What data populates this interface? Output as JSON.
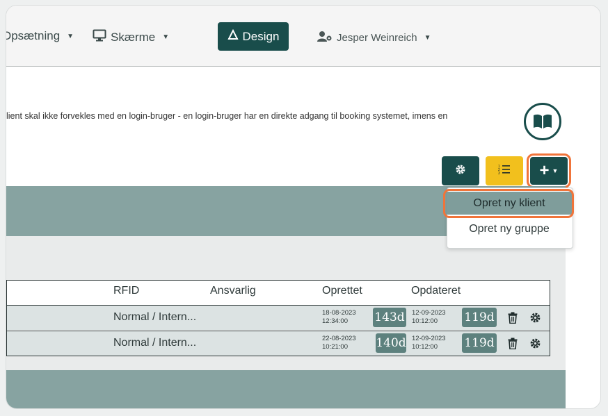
{
  "nav": {
    "opsaetning_label": "Opsætning",
    "skaerme_label": "Skærme",
    "design_label": "Design",
    "user_name": "Jesper Weinreich"
  },
  "description": "lient skal ikke forvekles med en login-bruger - en login-bruger har en direkte adgang til booking systemet, imens en",
  "dropdown": {
    "item1": "Opret ny klient",
    "item2": "Opret ny gruppe"
  },
  "table": {
    "headers": {
      "rfid": "RFID",
      "ansvarlig": "Ansvarlig",
      "oprettet": "Oprettet",
      "opdateret": "Opdateret"
    },
    "rows": [
      {
        "rfid": "Normal / Intern...",
        "created_date": "18-08-2023",
        "created_time": "12:34:00",
        "created_age": "143d",
        "updated_date": "12-09-2023",
        "updated_time": "10:12:00",
        "updated_age": "119d"
      },
      {
        "rfid": "Normal / Intern...",
        "created_date": "22-08-2023",
        "created_time": "10:21:00",
        "created_age": "140d",
        "updated_date": "12-09-2023",
        "updated_time": "10:12:00",
        "updated_age": "119d"
      }
    ]
  },
  "colors": {
    "brand": "#194d4b",
    "accent_yellow": "#f2c01d",
    "highlight": "#f0743a",
    "band": "#87a3a1"
  }
}
